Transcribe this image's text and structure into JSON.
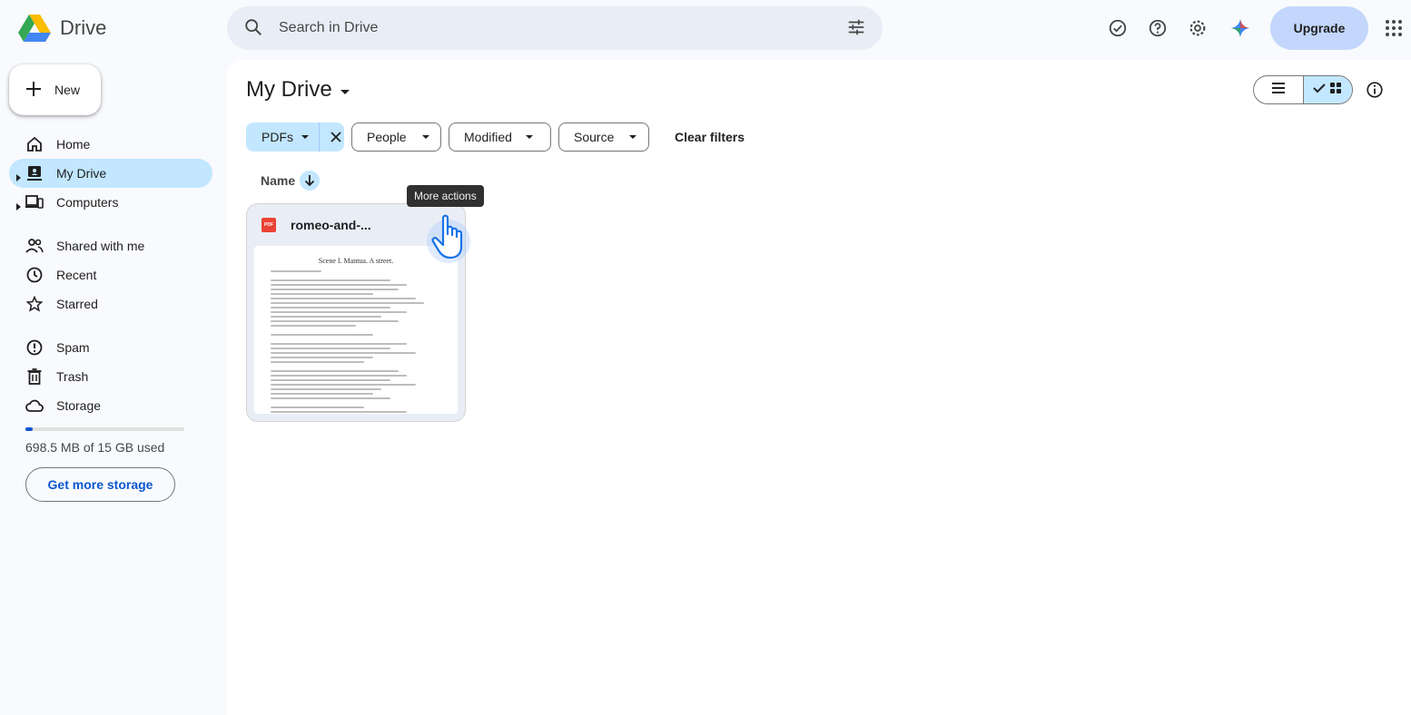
{
  "app": {
    "name": "Drive",
    "colors": {
      "accent": "#0b57d0",
      "selected": "#c2e7ff",
      "search_bg": "#e9eef6",
      "upgrade_bg": "#c2d7fb"
    }
  },
  "header": {
    "search_placeholder": "Search in Drive",
    "upgrade_label": "Upgrade",
    "icons": [
      "ready-for-offline-icon",
      "help-icon",
      "settings-icon",
      "gemini-icon",
      "apps-grid-icon"
    ]
  },
  "sidebar": {
    "new_label": "New",
    "items": [
      {
        "label": "Home",
        "icon": "home-icon"
      },
      {
        "label": "My Drive",
        "icon": "my-drive-icon",
        "active": true
      },
      {
        "label": "Computers",
        "icon": "computers-icon"
      },
      {
        "label": "Shared with me",
        "icon": "shared-icon"
      },
      {
        "label": "Recent",
        "icon": "clock-icon"
      },
      {
        "label": "Starred",
        "icon": "star-icon"
      },
      {
        "label": "Spam",
        "icon": "spam-icon"
      },
      {
        "label": "Trash",
        "icon": "trash-icon"
      },
      {
        "label": "Storage",
        "icon": "cloud-icon"
      }
    ],
    "storage": {
      "used_text": "698.5 MB of 15 GB used",
      "used_fraction": 0.045,
      "button_label": "Get more storage"
    }
  },
  "main": {
    "title": "My Drive",
    "filters": {
      "type": "PDFs",
      "people": "People",
      "modified": "Modified",
      "source": "Source",
      "clear": "Clear filters"
    },
    "sort_column": "Name",
    "tooltip": "More actions",
    "files": [
      {
        "name": "romeo-and-...",
        "type_badge": "PDF",
        "preview_title": "Scene I. Mantua. A street."
      }
    ]
  }
}
